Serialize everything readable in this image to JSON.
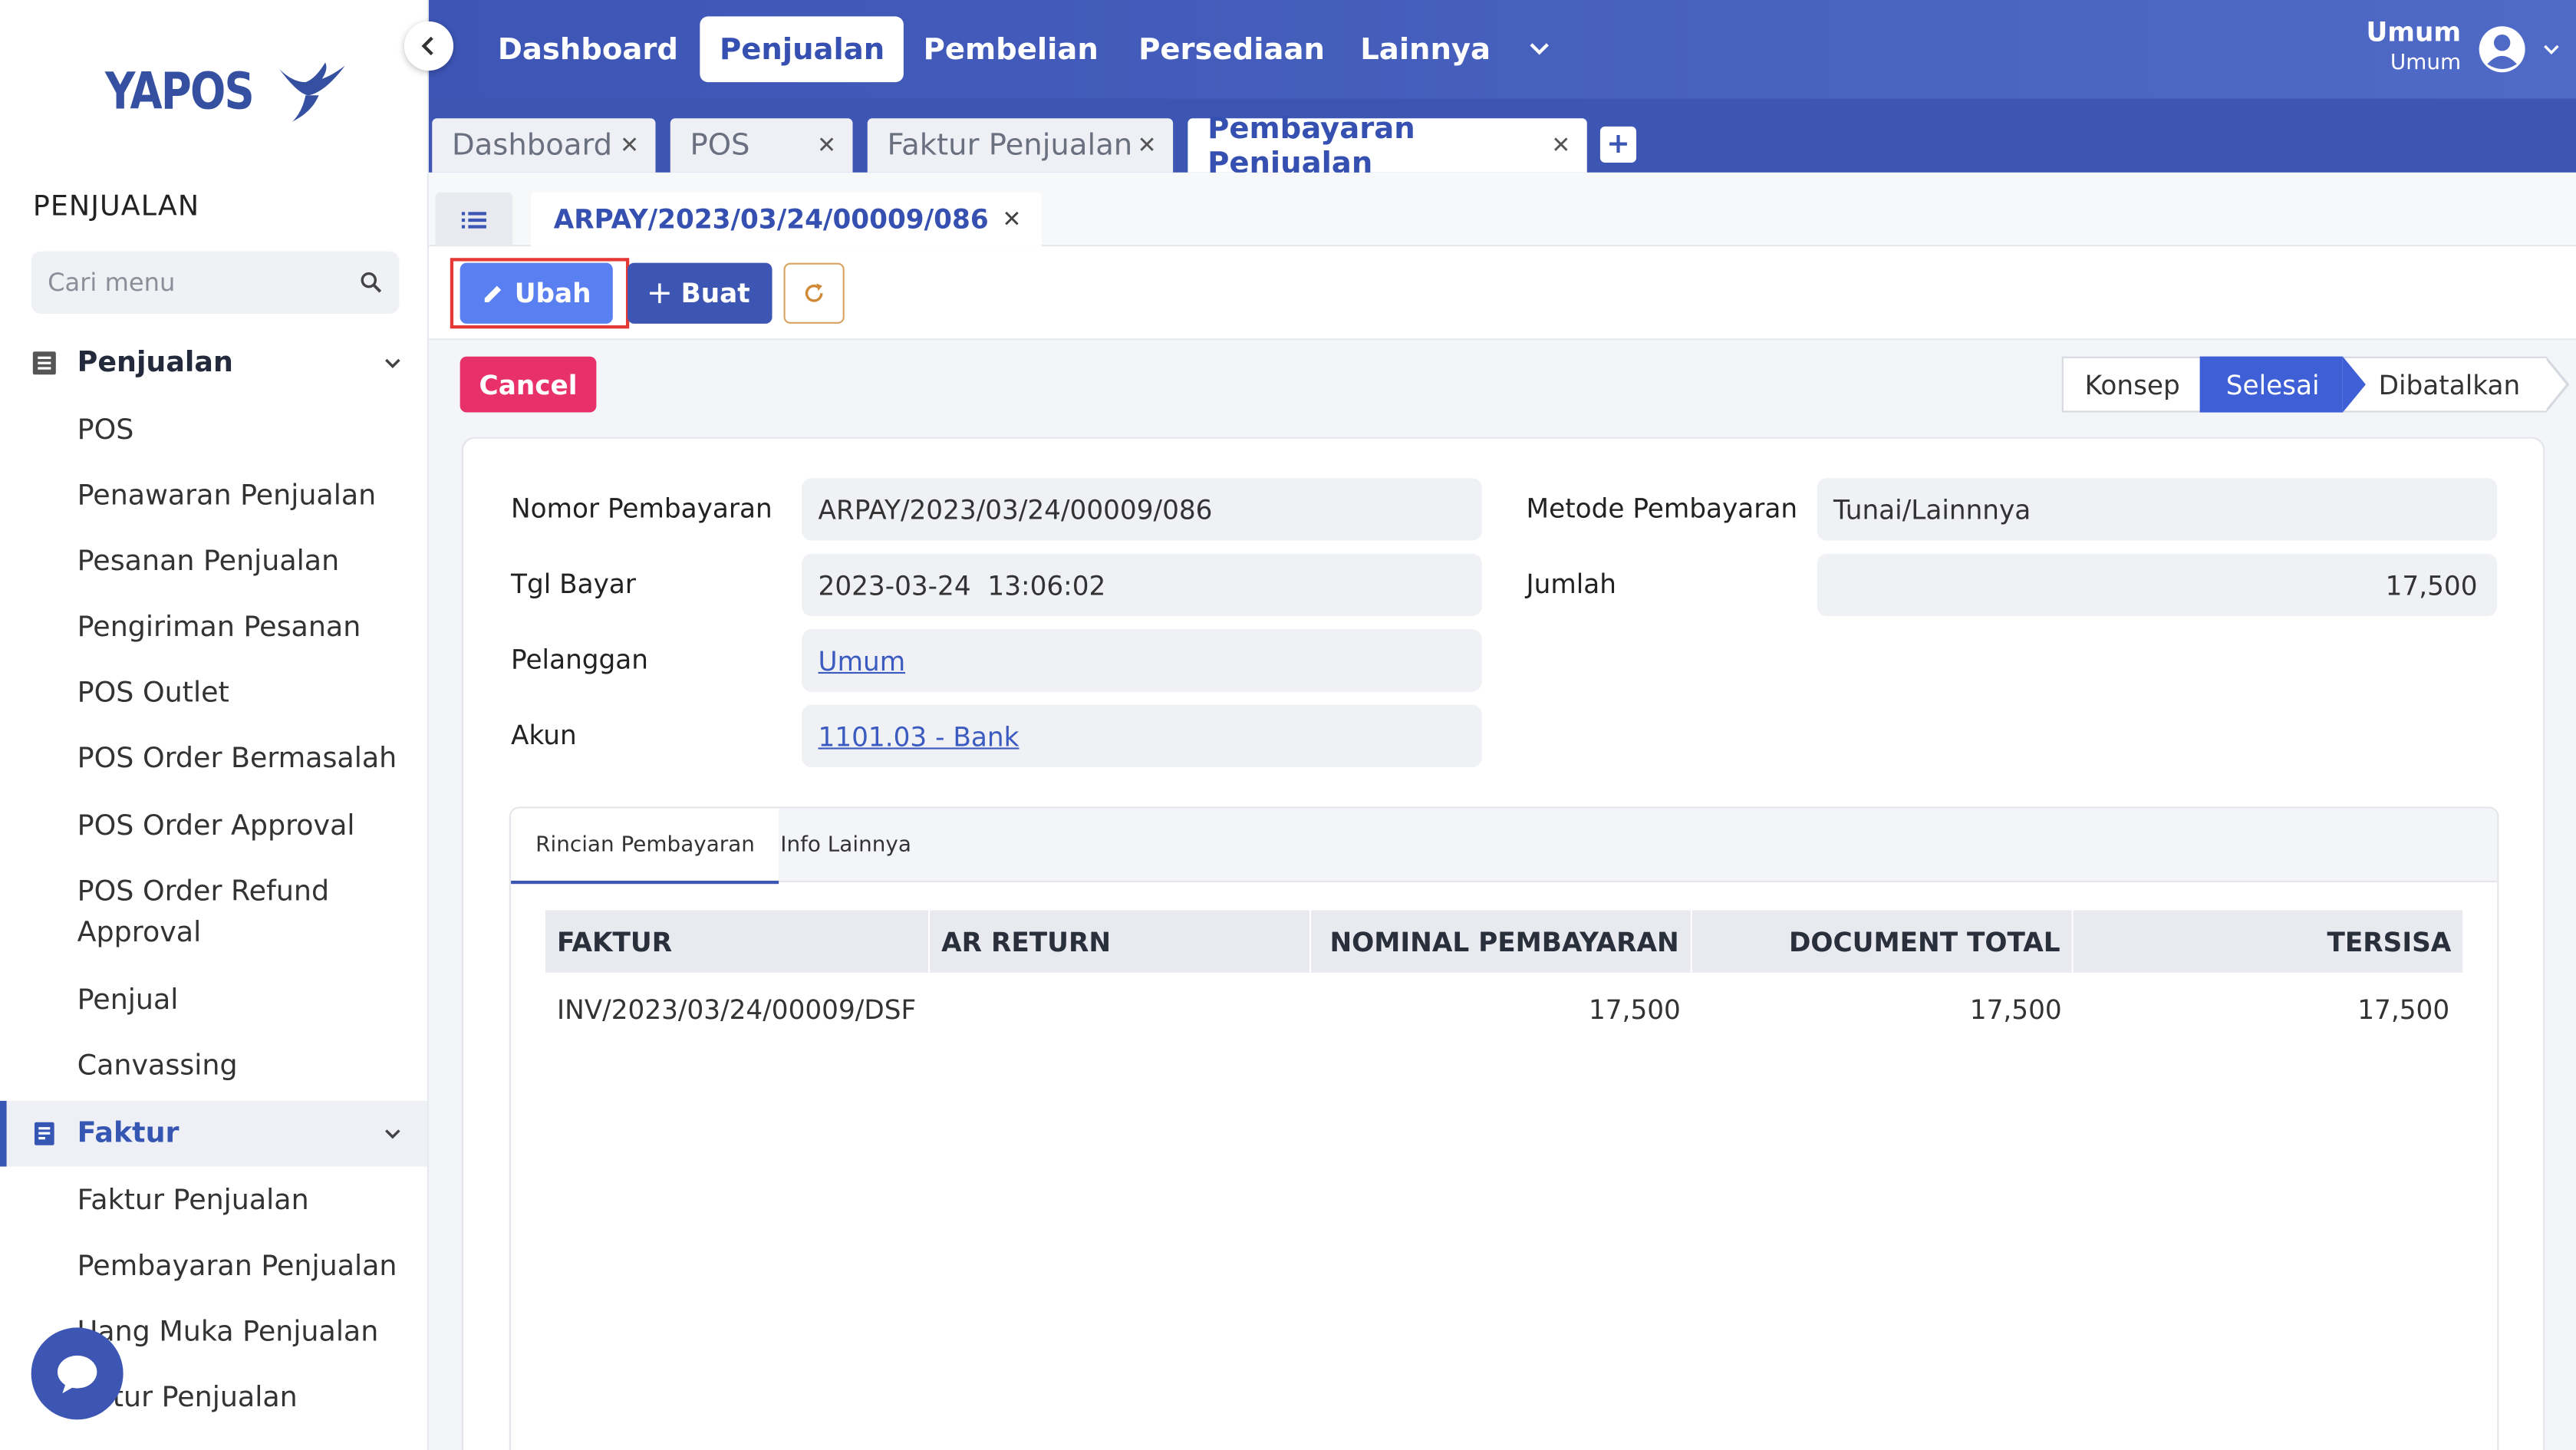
{
  "app": {
    "logo_text": "YAPOS"
  },
  "sidebar": {
    "section_title": "PENJUALAN",
    "search_placeholder": "Cari menu",
    "groups": [
      {
        "label": "Penjualan",
        "icon": "list-icon",
        "items": [
          "POS",
          "Penawaran Penjualan",
          "Pesanan Penjualan",
          "Pengiriman Pesanan",
          "POS Outlet",
          "POS Order Bermasalah",
          "POS Order Approval",
          "POS Order Refund Approval",
          "Penjual",
          "Canvassing"
        ]
      },
      {
        "label": "Faktur",
        "icon": "receipt-icon",
        "items": [
          "Faktur Penjualan",
          "Pembayaran Penjualan",
          "Uang Muka Penjualan",
          "Retur Penjualan"
        ]
      }
    ]
  },
  "topnav": {
    "items": [
      "Dashboard",
      "Penjualan",
      "Pembelian",
      "Persediaan",
      "Lainnya"
    ],
    "active": "Penjualan",
    "user": {
      "name": "Umum",
      "role": "Umum"
    }
  },
  "tabs": {
    "items": [
      "Dashboard",
      "POS",
      "Faktur Penjualan",
      "Pembayaran Penjualan"
    ],
    "active": "Pembayaran Penjualan",
    "add_label": "+"
  },
  "doc_tab": {
    "label": "ARPAY/2023/03/24/00009/086"
  },
  "toolbar": {
    "ubah_label": "Ubah",
    "buat_label": "Buat"
  },
  "actions": {
    "cancel_label": "Cancel"
  },
  "status": {
    "steps": [
      "Konsep",
      "Selesai",
      "Dibatalkan"
    ],
    "current": "Selesai"
  },
  "form": {
    "nomor_label": "Nomor Pembayaran",
    "nomor_value": "ARPAY/2023/03/24/00009/086",
    "tgl_label": "Tgl Bayar",
    "tgl_value": "2023-03-24  13:06:02",
    "pelanggan_label": "Pelanggan",
    "pelanggan_value": "Umum",
    "akun_label": "Akun",
    "akun_value": "1101.03 - Bank",
    "metode_label": "Metode Pembayaran",
    "metode_value": "Tunai/Lainnnya",
    "jumlah_label": "Jumlah",
    "jumlah_value": "17,500"
  },
  "detail": {
    "tabs": [
      "Rincian Pembayaran",
      "Info Lainnya"
    ],
    "active_tab": "Rincian Pembayaran",
    "columns": [
      "FAKTUR",
      "AR RETURN",
      "NOMINAL PEMBAYARAN",
      "DOCUMENT TOTAL",
      "TERSISA"
    ],
    "rows": [
      {
        "faktur": "INV/2023/03/24/00009/DSF",
        "ar_return": "",
        "nominal": "17,500",
        "total": "17,500",
        "tersisa": "17,500"
      }
    ]
  },
  "colors": {
    "primary": "#3d56b4",
    "accent": "#5a7ff0",
    "danger": "#e8306a",
    "highlight": "#e53935"
  }
}
